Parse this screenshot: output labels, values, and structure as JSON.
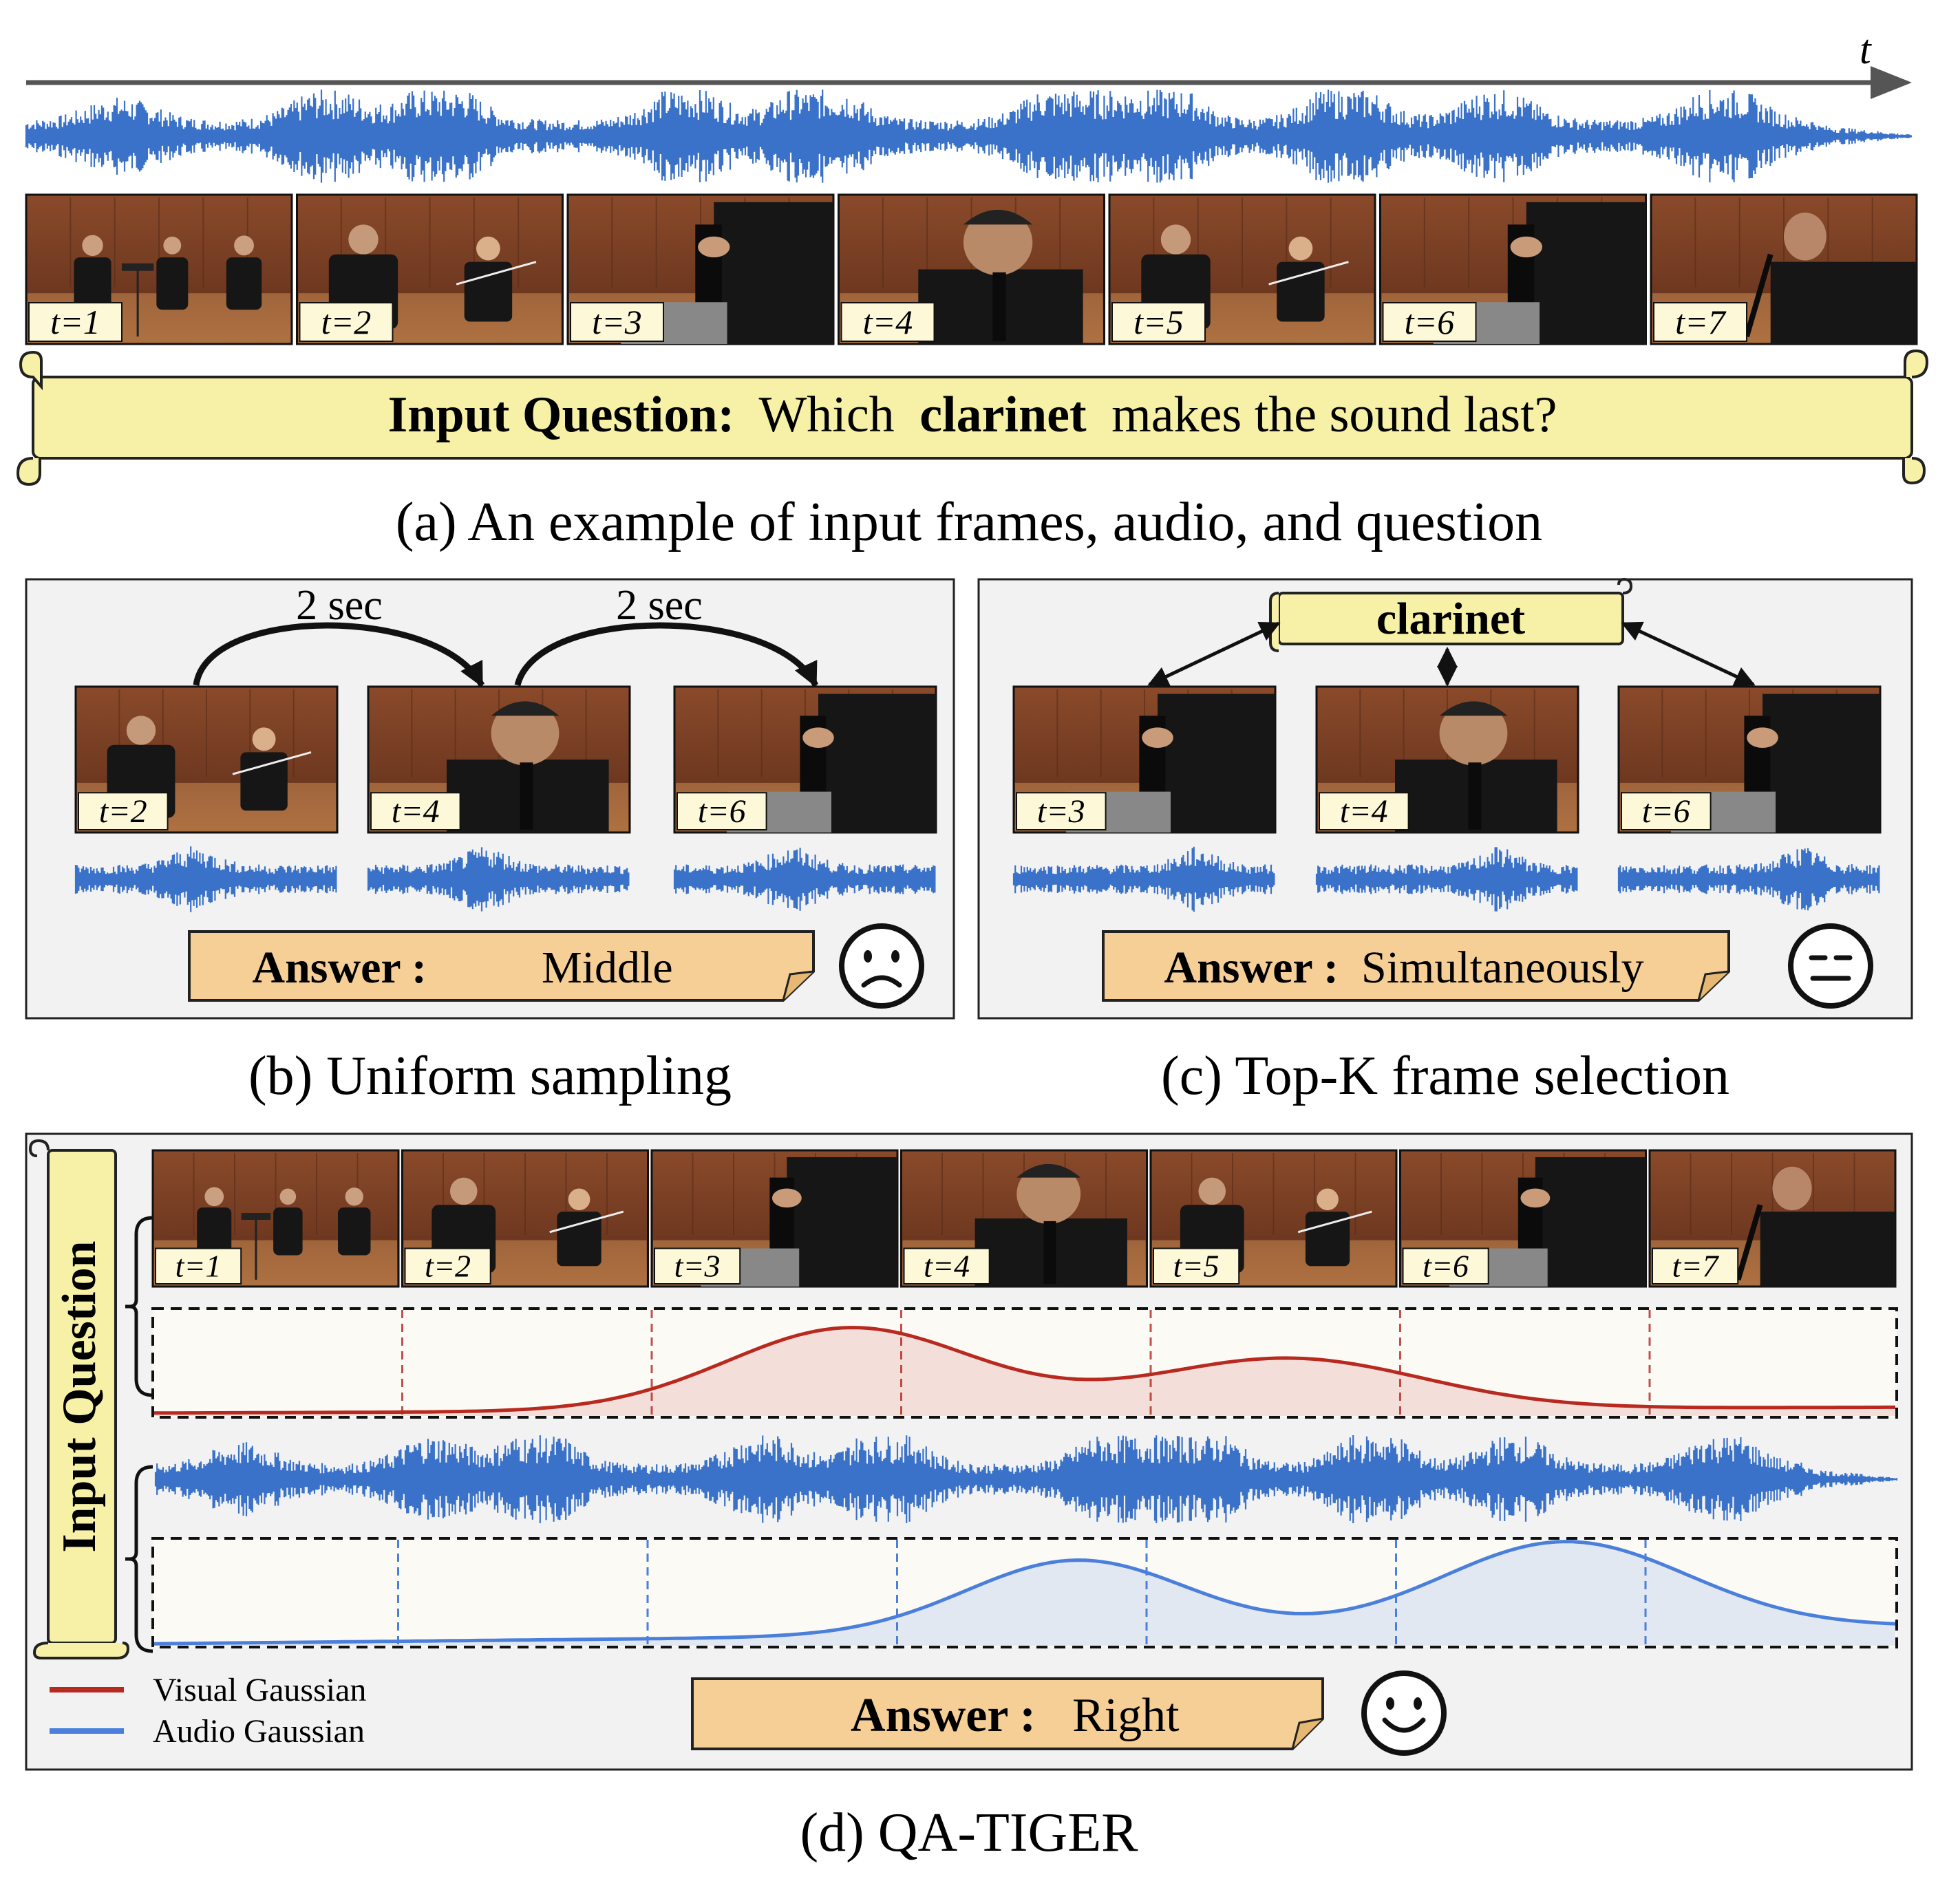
{
  "colors": {
    "wave": "#3a72c9",
    "scroll_fill": "#f6f1a6",
    "answer_fill": "#f6cf96",
    "panel_fill": "#f2f2f2",
    "visual_gaussian": "#b8291f",
    "audio_gaussian": "#4a7fdb",
    "frame_bg": "#6a3a22"
  },
  "time_axis_label": "t",
  "frames": [
    "t=1",
    "t=2",
    "t=3",
    "t=4",
    "t=5",
    "t=6",
    "t=7"
  ],
  "section_a": {
    "question_prefix": "Input Question:",
    "question_pre": "Which",
    "question_keyword": "clarinet",
    "question_post": "makes the sound last?",
    "caption": "(a) An example of input frames, audio, and question"
  },
  "section_b": {
    "interval_1": "2 sec",
    "interval_2": "2 sec",
    "frames": [
      "t=2",
      "t=4",
      "t=6"
    ],
    "answer_label": "Answer :",
    "answer_value": "Middle",
    "face": "sad-face-icon",
    "caption": "(b) Uniform sampling"
  },
  "section_c": {
    "keyword": "clarinet",
    "frames": [
      "t=3",
      "t=4",
      "t=6"
    ],
    "answer_label": "Answer :",
    "answer_value": "Simultaneously",
    "face": "neutral-face-icon",
    "caption": "(c) Top-K frame selection"
  },
  "section_d": {
    "side_label": "Input Question",
    "legend": [
      "Visual Gaussian",
      "Audio Gaussian"
    ],
    "answer_label": "Answer :",
    "answer_value": "Right",
    "face": "smiley-face-icon",
    "caption": "(d) QA-TIGER"
  }
}
